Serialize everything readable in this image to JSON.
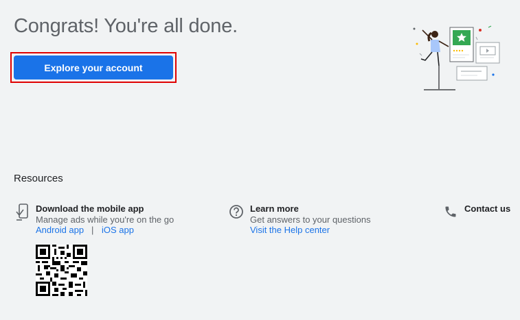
{
  "header": {
    "title": "Congrats! You're all done.",
    "cta_label": "Explore your account"
  },
  "resources": {
    "title": "Resources",
    "mobile_app": {
      "title": "Download the mobile app",
      "subtitle": "Manage ads while you're on the go",
      "android_label": "Android app",
      "separator": "|",
      "ios_label": "iOS app",
      "icon": "phone-download-icon"
    },
    "learn_more": {
      "title": "Learn more",
      "subtitle": "Get answers to your questions",
      "link_label": "Visit the Help center",
      "icon": "help-circle-icon"
    },
    "contact": {
      "title": "Contact us",
      "icon": "phone-icon"
    }
  },
  "colors": {
    "accent": "#1a73e8",
    "highlight_outline": "#e00000",
    "background": "#f1f3f4"
  }
}
